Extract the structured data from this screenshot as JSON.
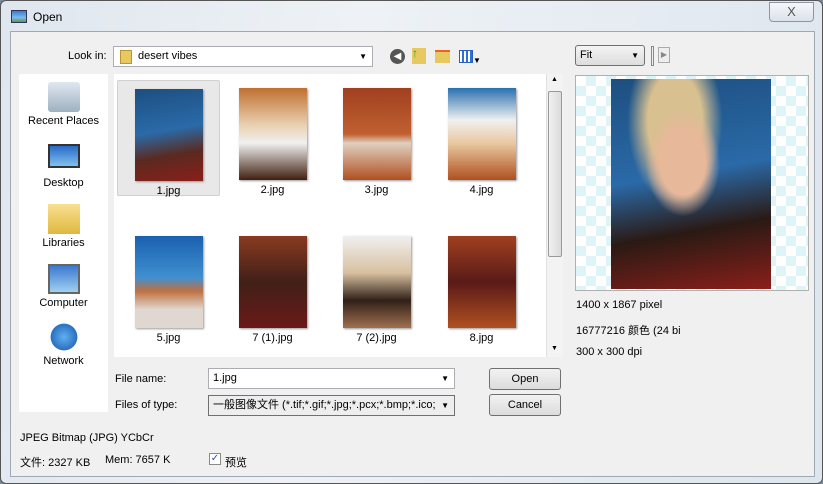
{
  "window": {
    "title": "Open",
    "close": "X"
  },
  "toolbar": {
    "look_in_label": "Look in:",
    "folder": "desert vibes",
    "icons": [
      "back-icon",
      "up-folder-icon",
      "new-folder-icon",
      "view-menu-icon"
    ]
  },
  "sidebar": {
    "items": [
      {
        "label": "Recent Places",
        "icon": "recent-places-icon"
      },
      {
        "label": "Desktop",
        "icon": "desktop-icon"
      },
      {
        "label": "Libraries",
        "icon": "libraries-icon"
      },
      {
        "label": "Computer",
        "icon": "computer-icon"
      },
      {
        "label": "Network",
        "icon": "network-icon"
      }
    ]
  },
  "files": [
    {
      "name": "1.jpg",
      "selected": true
    },
    {
      "name": "2.jpg"
    },
    {
      "name": "3.jpg"
    },
    {
      "name": "4.jpg"
    },
    {
      "name": "5.jpg"
    },
    {
      "name": "7 (1).jpg"
    },
    {
      "name": "7 (2).jpg"
    },
    {
      "name": "8.jpg"
    }
  ],
  "form": {
    "file_name_label": "File name:",
    "file_name": "1.jpg",
    "type_label": "Files of type:",
    "type_value": "一般图像文件 (*.tif;*.gif;*.jpg;*.pcx;*.bmp;*.ico;",
    "open": "Open",
    "cancel": "Cancel"
  },
  "preview": {
    "zoom": "Fit",
    "dims": "1400 x 1867 pixel",
    "colors": "16777216 颜色 (24 bi",
    "dpi": "300 x 300 dpi"
  },
  "status": {
    "format": "JPEG Bitmap (JPG) YCbCr",
    "file_size": "文件: 2327 KB",
    "mem": "Mem: 7657 KB",
    "preview_label": "预览",
    "preview_checked": true
  }
}
